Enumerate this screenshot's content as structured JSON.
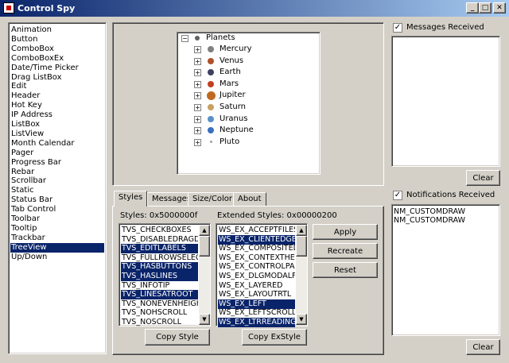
{
  "window": {
    "title": "Control Spy",
    "minimize_glyph": "_",
    "maximize_glyph": "□",
    "close_glyph": "✕"
  },
  "control_list": {
    "items": [
      "Animation",
      "Button",
      "ComboBox",
      "ComboBoxEx",
      "Date/Time Picker",
      "Drag ListBox",
      "Edit",
      "Header",
      "Hot Key",
      "IP Address",
      "ListBox",
      "ListView",
      "Month Calendar",
      "Pager",
      "Progress Bar",
      "Rebar",
      "Scrollbar",
      "Static",
      "Status Bar",
      "Tab Control",
      "Toolbar",
      "Tooltip",
      "Trackbar",
      "TreeView",
      "Up/Down"
    ],
    "selected": "TreeView"
  },
  "tree": {
    "root": "Planets",
    "root_expand": "−",
    "collapsed_glyph": "+",
    "children": [
      "Mercury",
      "Venus",
      "Earth",
      "Mars",
      "Jupiter",
      "Saturn",
      "Uranus",
      "Neptune",
      "Pluto"
    ],
    "colors": [
      "#808080",
      "#b0502a",
      "#404060",
      "#c04020",
      "#c06a20",
      "#c8a060",
      "#5a90c8",
      "#3a70c0",
      "#a0a0a0"
    ]
  },
  "tabs": [
    "Styles",
    "Messages",
    "Size/Color",
    "About"
  ],
  "active_tab": "Styles",
  "styles": {
    "label": "Styles: 0x5000000f",
    "items": [
      {
        "text": "TVS_CHECKBOXES",
        "sel": false
      },
      {
        "text": "TVS_DISABLEDRAGDROP",
        "sel": false
      },
      {
        "text": "TVS_EDITLABELS",
        "sel": true
      },
      {
        "text": "TVS_FULLROWSELECT",
        "sel": false
      },
      {
        "text": "TVS_HASBUTTONS",
        "sel": true
      },
      {
        "text": "TVS_HASLINES",
        "sel": true
      },
      {
        "text": "TVS_INFOTIP",
        "sel": false
      },
      {
        "text": "TVS_LINESATROOT",
        "sel": true
      },
      {
        "text": "TVS_NONEVENHEIGHT",
        "sel": false
      },
      {
        "text": "TVS_NOHSCROLL",
        "sel": false
      },
      {
        "text": "TVS_NOSCROLL",
        "sel": false
      }
    ],
    "copy_button": "Copy Style"
  },
  "ex_styles": {
    "label": "Extended Styles: 0x00000200",
    "items": [
      {
        "text": "WS_EX_ACCEPTFILES",
        "sel": false
      },
      {
        "text": "WS_EX_CLIENTEDGE",
        "sel": true
      },
      {
        "text": "WS_EX_COMPOSITED",
        "sel": false
      },
      {
        "text": "WS_EX_CONTEXTHELP",
        "sel": false
      },
      {
        "text": "WS_EX_CONTROLPARENT",
        "sel": false
      },
      {
        "text": "WS_EX_DLGMODALFRAME",
        "sel": false
      },
      {
        "text": "WS_EX_LAYERED",
        "sel": false
      },
      {
        "text": "WS_EX_LAYOUTRTL",
        "sel": false
      },
      {
        "text": "WS_EX_LEFT",
        "sel": true
      },
      {
        "text": "WS_EX_LEFTSCROLLBAR",
        "sel": false
      },
      {
        "text": "WS_EX_LTRREADING",
        "sel": true
      }
    ],
    "copy_button": "Copy ExStyle"
  },
  "actions": {
    "apply": "Apply",
    "recreate": "Recreate",
    "reset": "Reset"
  },
  "messages": {
    "label": "Messages Received",
    "checked": "✓",
    "clear": "Clear"
  },
  "notifications": {
    "label": "Notifications Received",
    "checked": "✓",
    "lines": [
      "NM_CUSTOMDRAW",
      "NM_CUSTOMDRAW"
    ],
    "clear": "Clear"
  }
}
